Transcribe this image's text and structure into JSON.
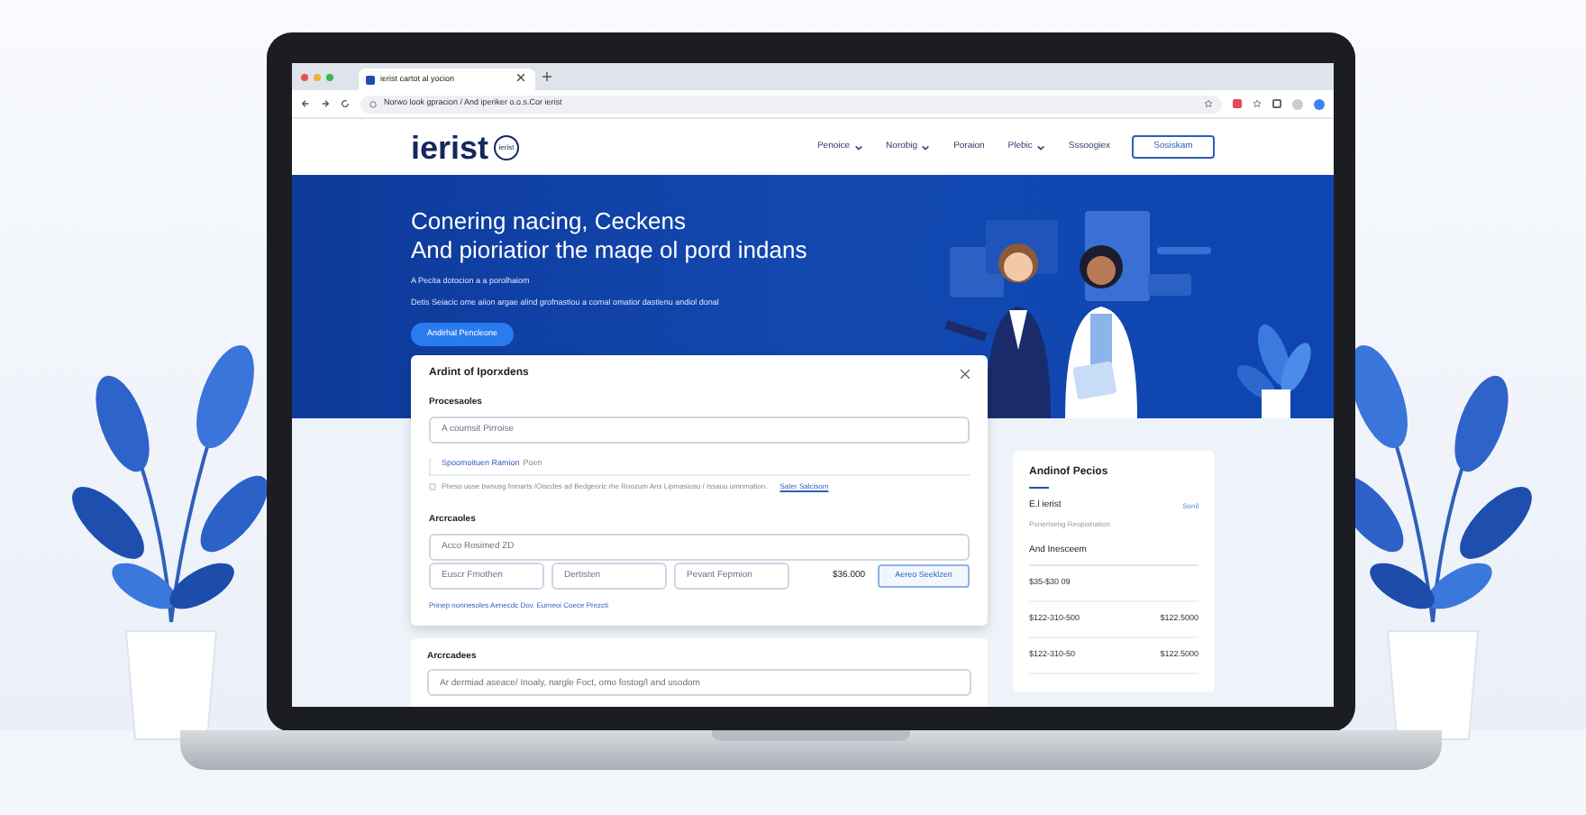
{
  "browser": {
    "tab_title": "ierist cartot al yocion",
    "address": "Norwo look gpracion / And iperiker o.o.s.Cor ierist"
  },
  "site": {
    "logo": "ierist",
    "logo_badge": "ierist",
    "nav": [
      {
        "label": "Penoice",
        "dropdown": true
      },
      {
        "label": "Norobig",
        "dropdown": true
      },
      {
        "label": "Poraion",
        "dropdown": false
      },
      {
        "label": "Plebic",
        "dropdown": true
      },
      {
        "label": "Sssoogiex",
        "dropdown": false
      }
    ],
    "nav_button": "Sosiskam"
  },
  "hero": {
    "title_lines": [
      "Conering nacing, Ceckens",
      "And pioriatior the maqe ol pord indans"
    ],
    "subtitle": "A Pecita dotocion a a porolhaiom",
    "description": "Detis Seiacic ome aiion argae alind grofnastiou a comal omatior dastienu andiol donal",
    "button": "Andirhal Pencleone"
  },
  "modal": {
    "title": "Ardint of Iporxdens",
    "section_1": "Procesaoles",
    "field_1": {
      "placeholder": "A coumsit Pirroise"
    },
    "link_1": "Spoomoituen Ramion",
    "link_1_suffix": "Poen",
    "consent": {
      "checked": false,
      "text": "Pheso uose bwsusg fomarts /Oiscdes ad Bedgeoric rhe Roozum Ans Lipmasiosu / Issauu umnmation.",
      "link": "Sater Salcisom"
    },
    "section_2": "Arcrcaoles",
    "field_2": {
      "placeholder": "Acco Rosimed ZD"
    },
    "fields": [
      {
        "placeholder": "Euscr Fmothen"
      },
      {
        "placeholder": "Dertisten"
      },
      {
        "placeholder": "Pevant Fepmion"
      }
    ],
    "price": "$36.000",
    "button": "Aereo Seeklzen",
    "footer_link": "Prinep nonnesoles Aenecdc Dov. Eurneoi Coece Prezcti"
  },
  "side_card": {
    "title": "Andinof Pecios",
    "name": "E.l ierist",
    "action": "Sonil",
    "subtitle": "Poneriseng Reopoination",
    "section": "And Inesceem",
    "rows": [
      {
        "label": "$35-$30 09"
      },
      {
        "label": "$122-310-500",
        "value": "$122.5000"
      },
      {
        "label": "$122-310-50",
        "value": "$122.5000"
      }
    ]
  },
  "bottom_card": {
    "title": "Arcrcadees",
    "field": {
      "placeholder": "Ar dermiad aseace/ Inoaly, nargle Foct, omo fostog/l and usodom"
    }
  }
}
